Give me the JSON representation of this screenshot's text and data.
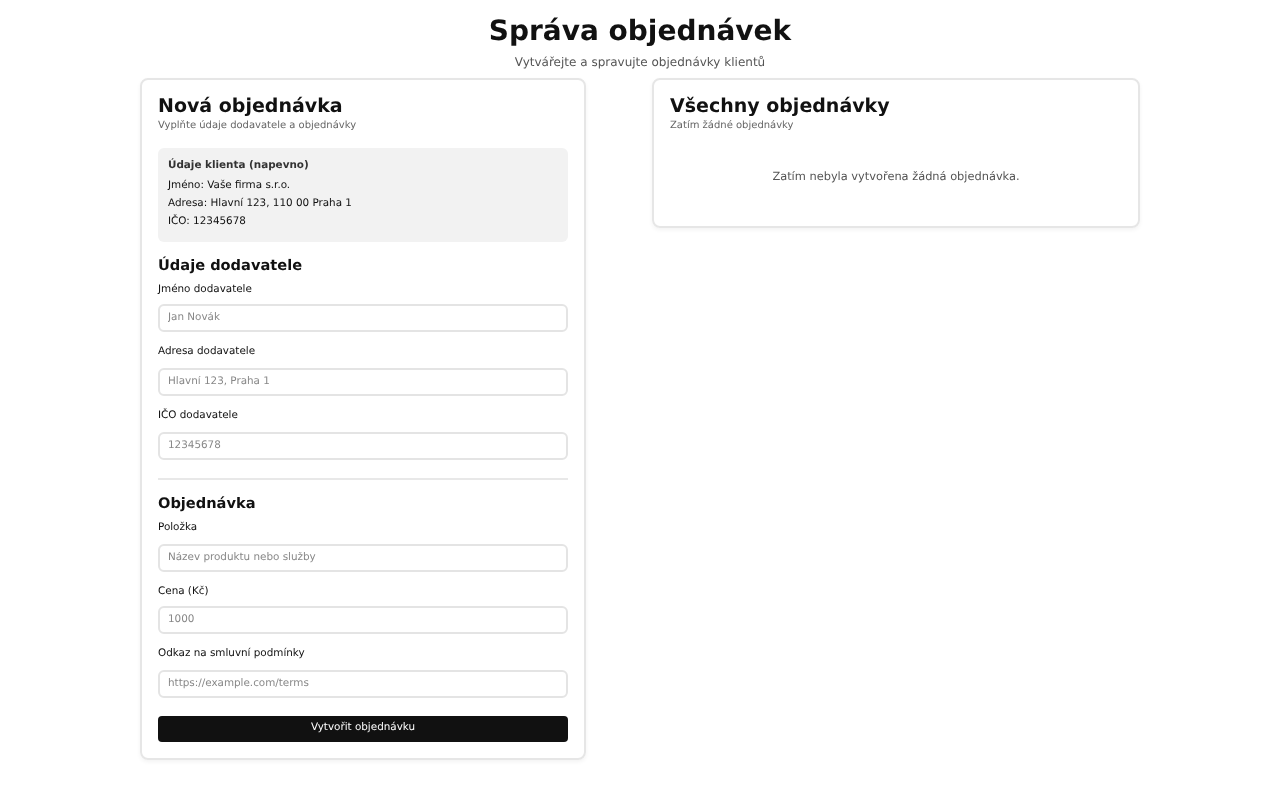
{
  "header": {
    "title": "Správa objednávek",
    "subtitle": "Vytvářejte a spravujte objednávky klientů"
  },
  "new_order": {
    "title": "Nová objednávka",
    "subtitle": "Vyplňte údaje dodavatele a objednávky",
    "client_box": {
      "heading": "Údaje klienta (napevno)",
      "lines": [
        "Jméno: Vaše firma s.r.o.",
        "Adresa: Hlavní 123, 110 00 Praha 1",
        "IČO: 12345678"
      ]
    },
    "sections": [
      {
        "heading": "Údaje dodavatele",
        "fields": [
          {
            "label": "Jméno dodavatele",
            "placeholder": "Jan Novák"
          },
          {
            "label": "Adresa dodavatele",
            "placeholder": "Hlavní 123, Praha 1"
          },
          {
            "label": "IČO dodavatele",
            "placeholder": "12345678"
          }
        ]
      },
      {
        "heading": "Objednávka",
        "fields": [
          {
            "label": "Položka",
            "placeholder": "Název produktu nebo služby"
          },
          {
            "label": "Cena (Kč)",
            "placeholder": "1000"
          },
          {
            "label": "Odkaz na smluvní podmínky",
            "placeholder": "https://example.com/terms"
          }
        ]
      }
    ],
    "submit_button": "Vytvořit objednávku"
  },
  "all_orders": {
    "title": "Všechny objednávky",
    "subtitle": "Zatím žádné objednávky",
    "empty_message": "Zatím nebyla vytvořena žádná objednávka."
  }
}
